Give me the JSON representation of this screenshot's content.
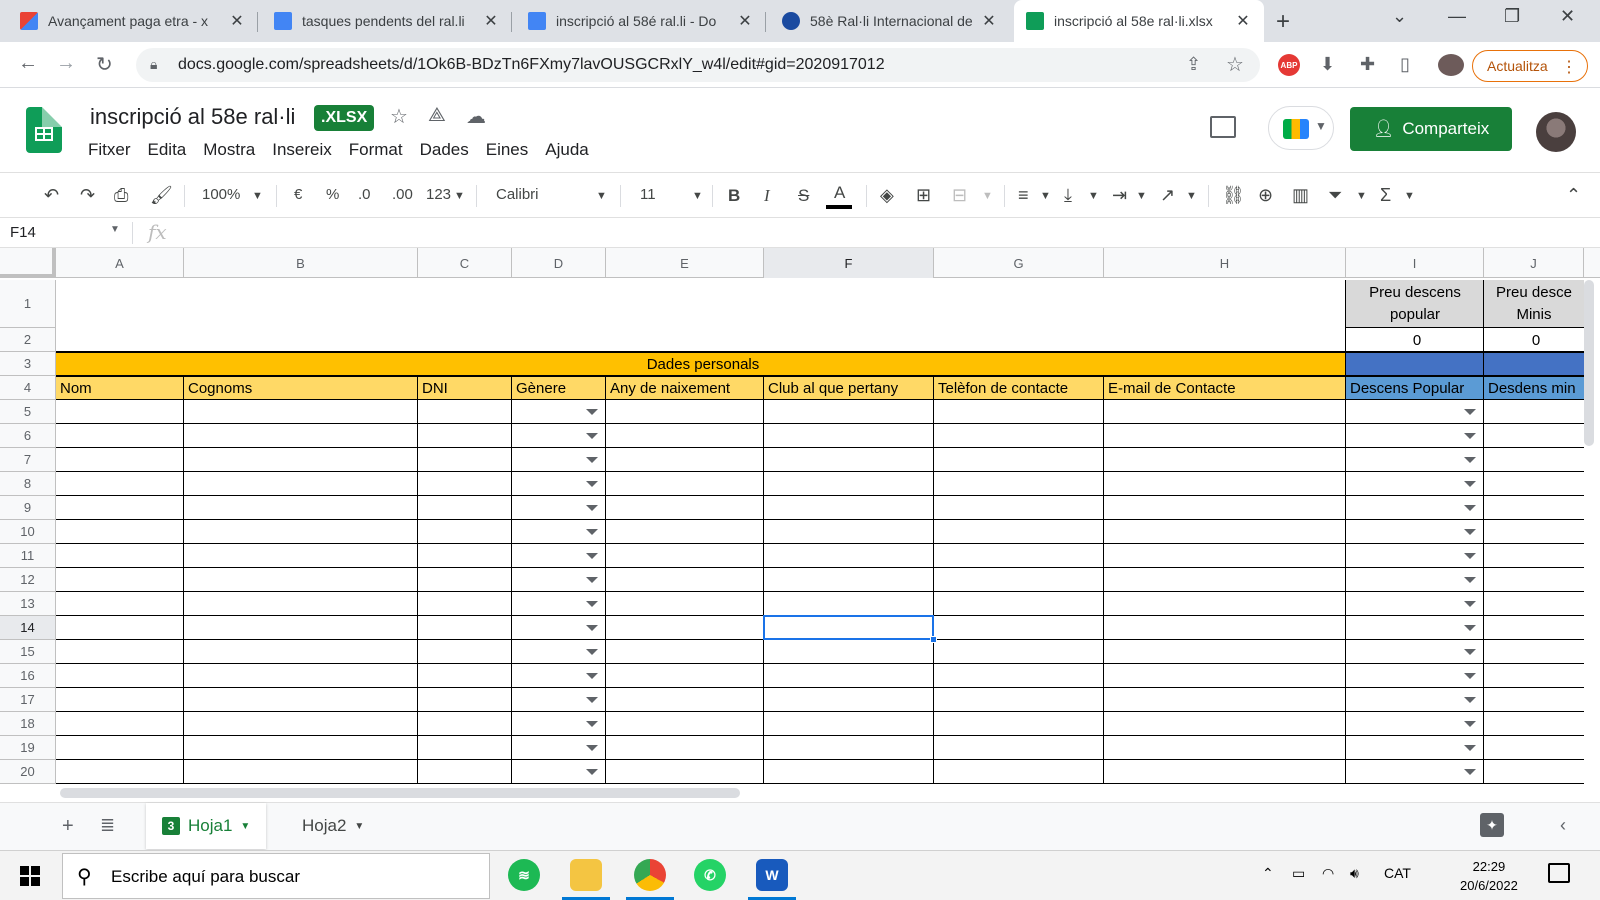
{
  "browser": {
    "tabs": [
      {
        "title": "Avançament paga etra - x",
        "favicon": "gmail-icon",
        "color": "#ea4335"
      },
      {
        "title": "tasques pendents del ral.li",
        "favicon": "docs-icon",
        "color": "#4285f4"
      },
      {
        "title": "inscripció al 58é ral.li - Do",
        "favicon": "docs-icon",
        "color": "#4285f4"
      },
      {
        "title": "58è Ral·li Internacional de",
        "favicon": "site-icon",
        "color": "#1a4aa0"
      },
      {
        "title": "inscripció al 58e ral·li.xlsx",
        "favicon": "sheets-icon",
        "color": "#0f9d58"
      }
    ],
    "url": "docs.google.com/spreadsheets/d/1Ok6B-BDzTn6FXmy7lavOUSGCRxlY_w4l/edit#gid=2020917012",
    "update_label": "Actualitza",
    "abp_label": "ABP"
  },
  "app": {
    "title": "inscripció al 58e ral·li",
    "badge": ".XLSX",
    "menu": [
      "Fitxer",
      "Edita",
      "Mostra",
      "Insereix",
      "Format",
      "Dades",
      "Eines",
      "Ajuda"
    ],
    "share_label": "Comparteix"
  },
  "toolbar": {
    "zoom": "100%",
    "currency": "€",
    "percent": "%",
    "dec_decrease": ".0",
    "dec_increase": ".00",
    "format": "123",
    "font": "Calibri",
    "font_size": "11",
    "bold": "B",
    "italic": "I",
    "strike": "S",
    "text_color": "A"
  },
  "formula_bar": {
    "cell_ref": "F14",
    "fx": "fx",
    "content": ""
  },
  "sheet": {
    "columns": [
      "A",
      "B",
      "C",
      "D",
      "E",
      "F",
      "G",
      "H",
      "I",
      "J"
    ],
    "selected_column": "F",
    "rows": [
      "1",
      "2",
      "3",
      "4",
      "5",
      "6",
      "7",
      "8",
      "9",
      "10",
      "11",
      "12",
      "13",
      "14",
      "15",
      "16",
      "17",
      "18",
      "19",
      "20"
    ],
    "selected_row": "14",
    "i1": "Preu descens popular",
    "j1": "Preu desce Minis",
    "i2": "0",
    "j2": "0",
    "section_title": "Dades personals",
    "headers": [
      "Nom",
      "Cognoms",
      "DNI",
      "Gènere",
      "Any de naixement",
      "Club al que pertany",
      "Telèfon de contacte",
      "E-mail de Contacte",
      "Descens Popular",
      "Desdens min"
    ],
    "colors": {
      "section": "#ffc000",
      "header": "#ffd966",
      "blue_section": "#4472c4",
      "blue_header": "#5b9bd5"
    }
  },
  "sheet_tabs": [
    {
      "label": "Hoja1",
      "badge": "3",
      "active": true
    },
    {
      "label": "Hoja2",
      "active": false
    }
  ],
  "taskbar": {
    "search_placeholder": "Escribe aquí para buscar",
    "language": "CAT",
    "time": "22:29",
    "date": "20/6/2022"
  }
}
